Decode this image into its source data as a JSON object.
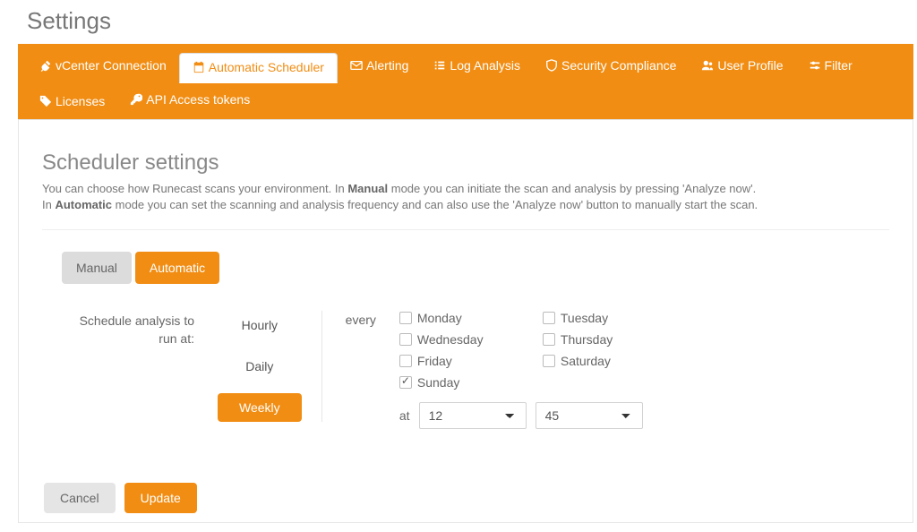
{
  "page": {
    "title": "Settings"
  },
  "tabs": [
    {
      "label": "vCenter Connection",
      "icon": "plug-icon",
      "active": false
    },
    {
      "label": "Automatic Scheduler",
      "icon": "calendar-icon",
      "active": true
    },
    {
      "label": "Alerting",
      "icon": "mail-icon",
      "active": false
    },
    {
      "label": "Log Analysis",
      "icon": "list-icon",
      "active": false
    },
    {
      "label": "Security Compliance",
      "icon": "shield-icon",
      "active": false
    },
    {
      "label": "User Profile",
      "icon": "users-icon",
      "active": false
    },
    {
      "label": "Filter",
      "icon": "sliders-icon",
      "active": false
    },
    {
      "label": "Licenses",
      "icon": "tag-icon",
      "active": false
    },
    {
      "label": "API Access tokens",
      "icon": "key-icon",
      "active": false
    }
  ],
  "section": {
    "title": "Scheduler settings",
    "desc1a": "You can choose how Runecast scans your environment. In ",
    "desc1b": "Manual",
    "desc1c": " mode you can initiate the scan and analysis by pressing 'Analyze now'.",
    "desc2a": "In ",
    "desc2b": "Automatic",
    "desc2c": " mode you can set the scanning and analysis frequency and can also use the 'Analyze now' button to manually start the scan."
  },
  "mode": {
    "manual": "Manual",
    "automatic": "Automatic",
    "selected": "Automatic"
  },
  "schedule": {
    "label": "Schedule analysis to run at:",
    "freq": {
      "hourly": "Hourly",
      "daily": "Daily",
      "weekly": "Weekly",
      "selected": "Weekly"
    },
    "every_label": "every",
    "days": {
      "monday": "Monday",
      "tuesday": "Tuesday",
      "wednesday": "Wednesday",
      "thursday": "Thursday",
      "friday": "Friday",
      "saturday": "Saturday",
      "sunday": "Sunday",
      "checked": [
        "sunday"
      ]
    },
    "at_label": "at",
    "hour": "12",
    "minute": "45"
  },
  "buttons": {
    "cancel": "Cancel",
    "update": "Update"
  }
}
